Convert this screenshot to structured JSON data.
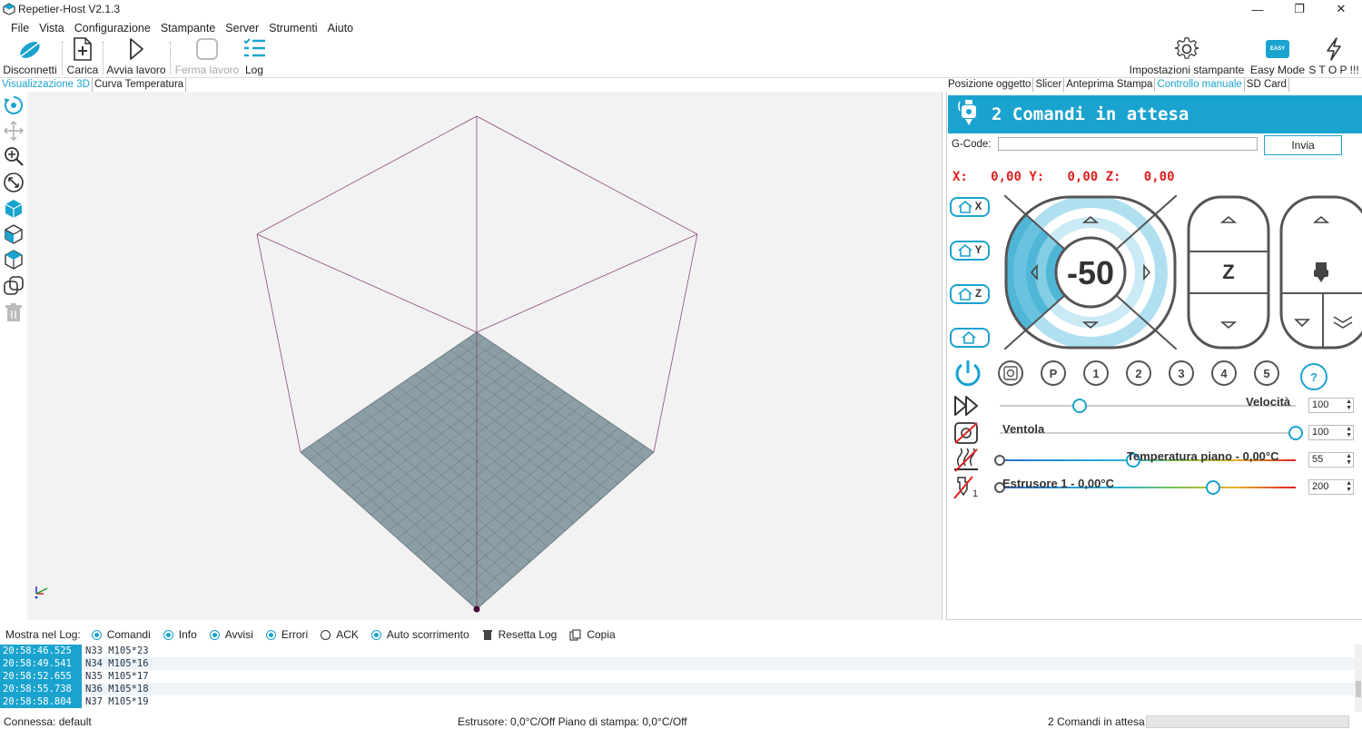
{
  "window": {
    "title": "Repetier-Host V2.1.3"
  },
  "menu": [
    "File",
    "Vista",
    "Configurazione",
    "Stampante",
    "Server",
    "Strumenti",
    "Aiuto"
  ],
  "toolbar": {
    "disconnect": "Disconnetti",
    "load": "Carica",
    "start_job": "Avvia lavoro",
    "stop_job": "Ferma lavoro",
    "log": "Log",
    "printer_settings": "Impostazioni stampante",
    "easy_mode": "Easy Mode",
    "easy_badge": "EASY",
    "stop_all": "S T O P !!!"
  },
  "left_tabs": [
    "Visualizzazione 3D",
    "Curva Temperatura"
  ],
  "right_tabs": [
    "Posizione oggetto",
    "Slicer",
    "Anteprima Stampa",
    "Controllo manuale",
    "SD Card"
  ],
  "manual": {
    "pending": "2 Comandi in attesa",
    "gcode_label": "G-Code:",
    "gcode_value": "",
    "send": "Invia",
    "coords": {
      "x_label": "X:",
      "x": "0,00",
      "y_label": "Y:",
      "y": "0,00",
      "z_label": "Z:",
      "z": "0,00"
    },
    "home": {
      "x": "X",
      "y": "Y",
      "z": "Z"
    },
    "jog_step": "-50",
    "z_label": "Z",
    "presets": [
      "P",
      "1",
      "2",
      "3",
      "4",
      "5"
    ],
    "help": "?",
    "speed": {
      "label": "Velocità",
      "value": "100",
      "level": 0.27
    },
    "fan": {
      "label": "Ventola",
      "value": "100",
      "level": 1.0
    },
    "bed": {
      "label": "Temperatura piano - 0,00°C",
      "value": "55",
      "level": 0.45
    },
    "extruder": {
      "label": "Estrusore 1 - 0,00°C",
      "value": "200",
      "level": 0.72,
      "index": "1"
    }
  },
  "log": {
    "show_label": "Mostra nel Log:",
    "options": [
      {
        "label": "Comandi",
        "checked": true
      },
      {
        "label": "Info",
        "checked": true
      },
      {
        "label": "Avvisi",
        "checked": true
      },
      {
        "label": "Errori",
        "checked": true
      },
      {
        "label": "ACK",
        "checked": false
      },
      {
        "label": "Auto scorrimento",
        "checked": true
      }
    ],
    "reset": "Resetta Log",
    "copy": "Copia",
    "rows": [
      {
        "time": "20:58:46.525",
        "msg": "N33 M105*23"
      },
      {
        "time": "20:58:49.541",
        "msg": "N34 M105*16"
      },
      {
        "time": "20:58:52.655",
        "msg": "N35 M105*17"
      },
      {
        "time": "20:58:55.738",
        "msg": "N36 M105*18"
      },
      {
        "time": "20:58:58.804",
        "msg": "N37 M105*19"
      }
    ]
  },
  "status": {
    "connection": "Connessa: default",
    "temps": "Estrusore: 0,0°C/Off Piano di stampa: 0,0°C/Off",
    "pending": "2 Comandi in attesa"
  },
  "colors": {
    "accent": "#1aa3cf",
    "coords": "#e02020",
    "bed": "#8c9ea6"
  }
}
